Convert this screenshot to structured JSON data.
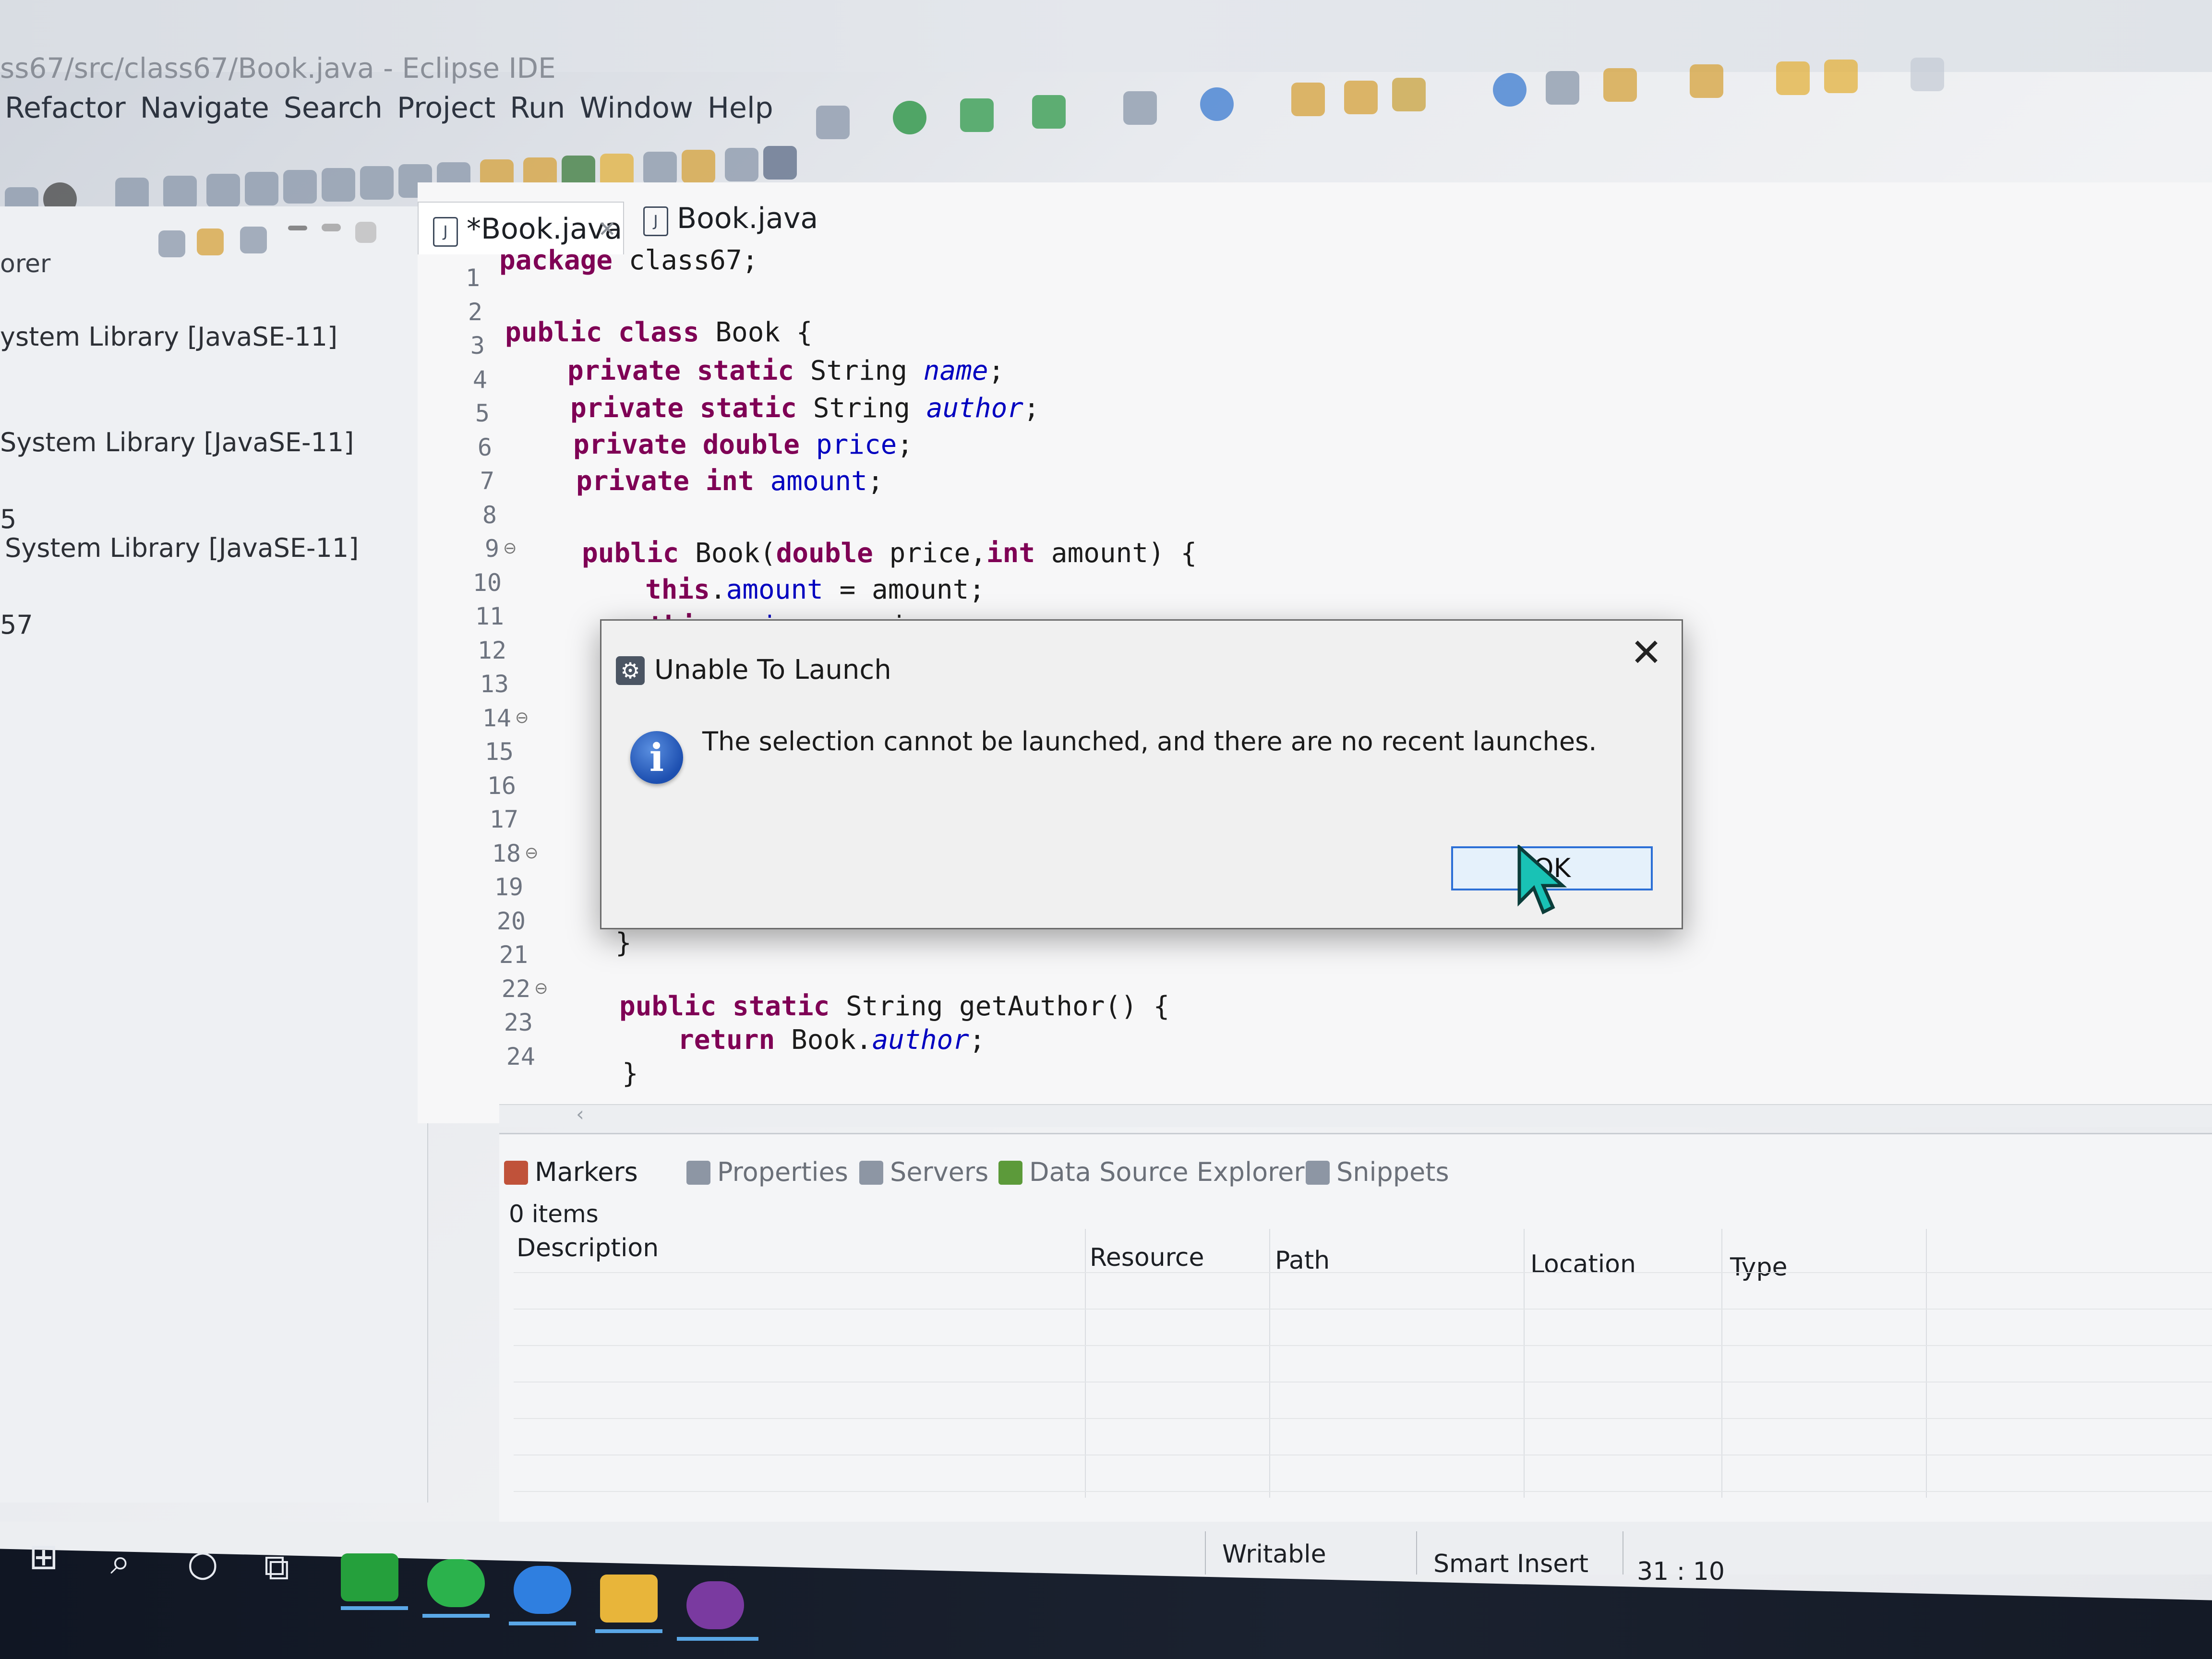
{
  "window": {
    "title": "ss67/src/class67/Book.java - Eclipse IDE"
  },
  "menu": [
    "Refactor",
    "Navigate",
    "Search",
    "Project",
    "Run",
    "Window",
    "Help"
  ],
  "sidebar": {
    "header": "orer",
    "items": [
      "ystem Library [JavaSE-11]",
      "System Library [JavaSE-11]",
      "5",
      "System Library [JavaSE-11]",
      "57"
    ]
  },
  "editor_tabs": [
    {
      "label": "*Book.java",
      "icon": "java-file-icon",
      "active": true
    },
    {
      "label": "Book.java",
      "icon": "java-file-icon",
      "active": false
    }
  ],
  "code": {
    "line_numbers": [
      "1",
      "2",
      "3",
      "4",
      "5",
      "6",
      "7",
      "8",
      "9",
      "10",
      "11",
      "12",
      "13",
      "14",
      "15",
      "16",
      "17",
      "18",
      "19",
      "20",
      "21",
      "22",
      "23",
      "24"
    ],
    "fold_lines": [
      "9",
      "14",
      "18",
      "22"
    ],
    "l1a": "package",
    "l1b": " class67;",
    "l3a": "public class",
    "l3b": " Book {",
    "l4a": "private static",
    "l4b": " String ",
    "l4c": "name",
    "l4d": ";",
    "l5a": "private static",
    "l5b": " String ",
    "l5c": "author",
    "l5d": ";",
    "l6a": "private double",
    "l6b": " ",
    "l6c": "price",
    "l6d": ";",
    "l7a": "private int",
    "l7b": " ",
    "l7c": "amount",
    "l7d": ";",
    "l9a": "public",
    "l9b": " Book(",
    "l9c": "double",
    "l9d": " price,",
    "l9e": "int",
    "l9f": " amount) {",
    "l10a": "this",
    "l10b": ".",
    "l10c": "amount",
    "l10d": " = amount;",
    "l11a": "this",
    "l11b": ".",
    "l11c": "price",
    "l11d": " = price;",
    "l20": "}",
    "l22a": "public static",
    "l22b": " String getAuthor() {",
    "l23a": "return",
    "l23b": " Book.",
    "l23c": "author",
    "l23d": ";",
    "l24": "}"
  },
  "dialog": {
    "title": "Unable To Launch",
    "message": "The selection cannot be launched, and there are no recent launches.",
    "ok_label": "OK",
    "close_glyph": "✕",
    "icon": "info-icon"
  },
  "bottom_panel": {
    "tabs": [
      "Markers",
      "Properties",
      "Servers",
      "Data Source Explorer",
      "Snippets"
    ],
    "count": "0 items",
    "columns": [
      "Description",
      "Resource",
      "Path",
      "Location",
      "Type"
    ]
  },
  "status": {
    "writable": "Writable",
    "insert_mode": "Smart Insert",
    "position": "31 : 10"
  },
  "colors": {
    "keyword": "#7f0055",
    "field": "#0000c0",
    "ok_border": "#2b6fd6",
    "info_icon": "#1d4fb0"
  }
}
